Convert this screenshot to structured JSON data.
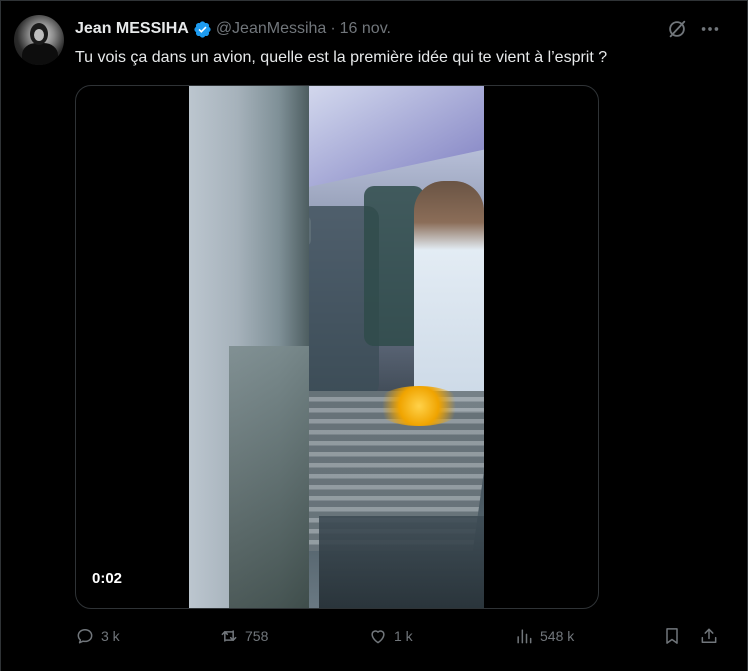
{
  "tweet": {
    "author_name": "Jean MESSIHA",
    "handle": "@JeanMessiha",
    "separator": "·",
    "date": "16 nov.",
    "text": "Tu vois ça dans un avion, quelle est la première idée qui te vient à l’esprit ?",
    "verified_color": "#1d9bf0"
  },
  "media": {
    "video_timestamp": "0:02"
  },
  "actions": {
    "replies": "3 k",
    "retweets": "758",
    "likes": "1 k",
    "views": "548 k"
  },
  "icons": {
    "header": [
      "grok-icon",
      "more-icon"
    ],
    "actions": [
      "reply-icon",
      "retweet-icon",
      "like-icon",
      "views-icon",
      "bookmark-icon",
      "share-icon"
    ]
  }
}
